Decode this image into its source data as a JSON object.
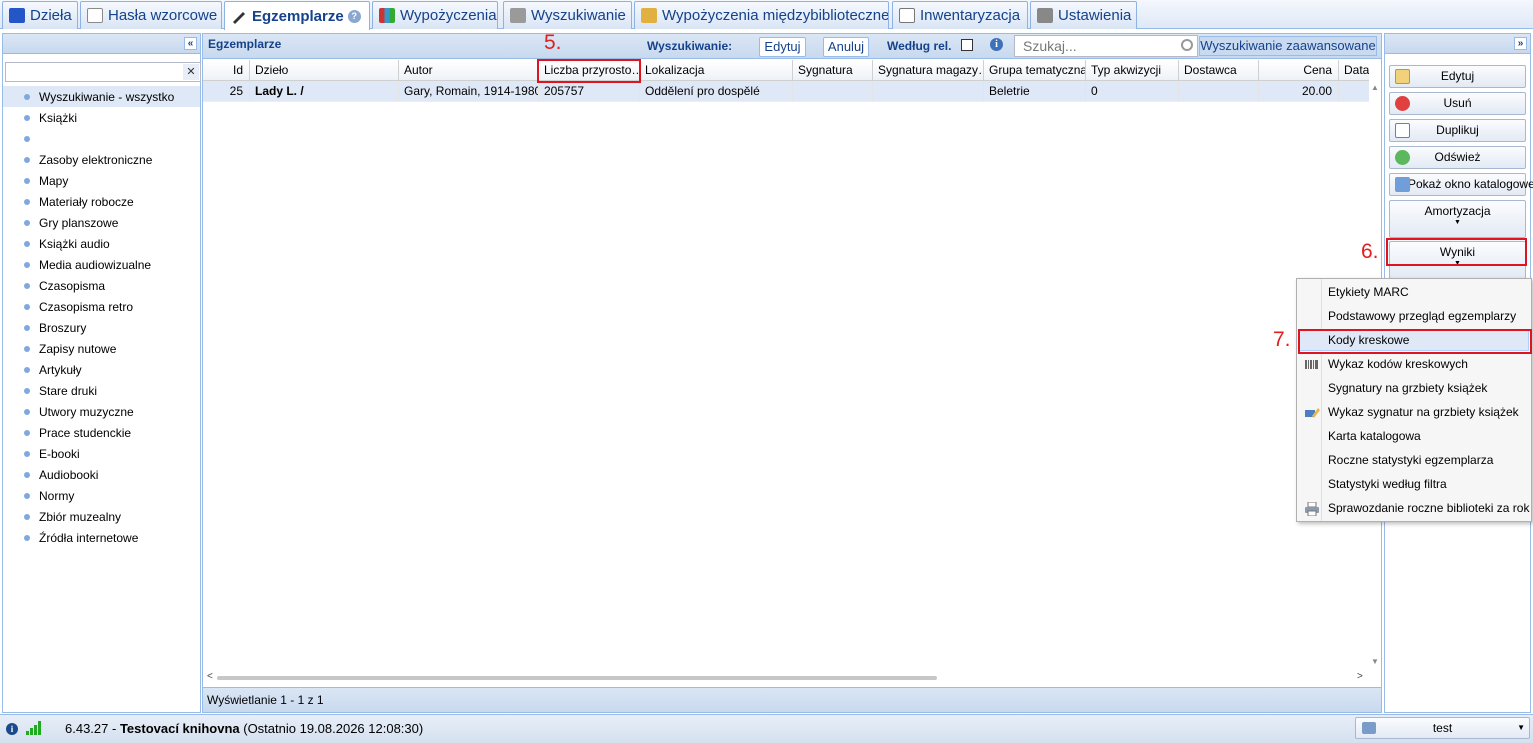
{
  "tabs": [
    {
      "label": "Dzieła",
      "icon": "book-icon"
    },
    {
      "label": "Hasła wzorcowe",
      "icon": "card-icon"
    },
    {
      "label": "Egzemplarze",
      "icon": "pen-icon"
    },
    {
      "label": "Wypożyczenia",
      "icon": "books-icon"
    },
    {
      "label": "Wyszukiwanie",
      "icon": "search-doc-icon"
    },
    {
      "label": "Wypożyczenia międzybiblioteczne",
      "icon": "box-icon"
    },
    {
      "label": "Inwentaryzacja",
      "icon": "list-icon"
    },
    {
      "label": "Ustawienia",
      "icon": "tools-icon"
    }
  ],
  "sidebar": {
    "collapse_glyph": "«",
    "filter_clear": "✕",
    "items": [
      "Wyszukiwanie - wszystko",
      "Książki",
      "",
      "Zasoby elektroniczne",
      "Mapy",
      "Materiały robocze",
      "Gry planszowe",
      "Książki audio",
      "Media audiowizualne",
      "Czasopisma",
      "Czasopisma retro",
      "Broszury",
      "Zapisy nutowe",
      "Artykuły",
      "Stare druki",
      "Utwory muzyczne",
      "Prace studenckie",
      "E-booki",
      "Audiobooki",
      "Normy",
      "Zbiór muzealny",
      "Źródła internetowe"
    ]
  },
  "toolbar": {
    "title": "Egzemplarze",
    "search_label": "Wyszukiwanie:",
    "edit": "Edytuj",
    "cancel": "Anuluj",
    "relevance_label": "Według rel.",
    "info": "i",
    "search_placeholder": "Szukaj...",
    "advanced": "Wyszukiwanie zaawansowane"
  },
  "grid": {
    "columns": [
      "Id",
      "Dzieło",
      "Autor",
      "Liczba przyrosto…",
      "Lokalizacja",
      "Sygnatura",
      "Sygnatura magazy…",
      "Grupa tematyczna",
      "Typ akwizycji",
      "Dostawca",
      "Cena",
      "Data utw"
    ],
    "rows": [
      [
        "25",
        "Lady L. /",
        "Gary, Romain, 1914-1980",
        "205757",
        "Oddělení pro dospělé",
        "",
        "",
        "Beletrie",
        "0",
        "",
        "20.00",
        ""
      ]
    ],
    "footer": "Wyświetlanie 1 - 1 z 1"
  },
  "actions": {
    "expand_glyph": "»",
    "edit": "Edytuj",
    "delete": "Usuń",
    "duplicate": "Duplikuj",
    "refresh": "Odśwież",
    "show_catalog": "Pokaż okno katalogowe",
    "depreciation": "Amortyzacja",
    "results": "Wyniki",
    "caret": "▼"
  },
  "results_menu": [
    {
      "label": "Etykiety MARC",
      "icon": ""
    },
    {
      "label": "Podstawowy przegląd egzemplarzy",
      "icon": ""
    },
    {
      "label": "Kody kreskowe",
      "icon": ""
    },
    {
      "label": "Wykaz kodów kreskowych",
      "icon": "barcode-icon"
    },
    {
      "label": "Sygnatury na grzbiety książek",
      "icon": ""
    },
    {
      "label": "Wykaz sygnatur na grzbiety książek",
      "icon": "pencil-icon"
    },
    {
      "label": "Karta katalogowa",
      "icon": ""
    },
    {
      "label": "Roczne statystyki egzemplarza",
      "icon": ""
    },
    {
      "label": "Statystyki według filtra",
      "icon": ""
    },
    {
      "label": "Sprawozdanie roczne biblioteki za rok",
      "icon": "printer-icon"
    }
  ],
  "annotations": [
    "5.",
    "6.",
    "7."
  ],
  "status": {
    "version": "6.43.27",
    "separator": " - ",
    "library": "Testovací knihovna",
    "last_login": " (Ostatnio 19.08.2026 12:08:30)",
    "user": "test",
    "info": "i",
    "dropdown": "▼"
  },
  "colors": {
    "accent": "#15428b",
    "selection": "#dfe8f6",
    "annotation": "#e0141e"
  }
}
